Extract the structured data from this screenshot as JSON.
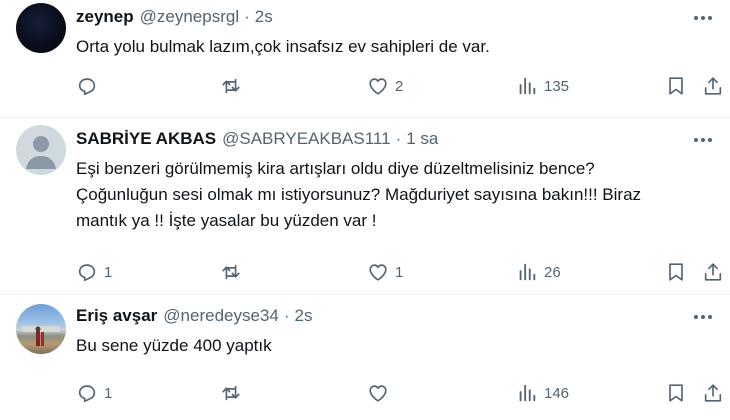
{
  "tweets": [
    {
      "name": "zeynep",
      "handle": "@zeynepsrgl",
      "dot": "·",
      "time": "2s",
      "lines": [
        "Orta yolu bulmak lazım,çok insafsız ev sahipleri de var."
      ],
      "reply_count": "",
      "retweet_count": "",
      "like_count": "2",
      "view_count": "135"
    },
    {
      "name": "SABRİYE AKBAS",
      "handle": "@SABRYEAKBAS111",
      "dot": "·",
      "time": "1 sa",
      "lines": [
        "Eşi benzeri görülmemiş kira artışları oldu diye düzeltmelisiniz bence?",
        "Çoğunluğun sesi olmak mı istiyorsunuz? Mağduriyet sayısına bakın!!! Biraz",
        "mantık ya !! İşte yasalar bu yüzden var !"
      ],
      "reply_count": "1",
      "retweet_count": "",
      "like_count": "1",
      "view_count": "26"
    },
    {
      "name": "Eriş avşar",
      "handle": "@neredeyse34",
      "dot": "·",
      "time": "2s",
      "lines": [
        "Bu sene yüzde 400 yaptık"
      ],
      "reply_count": "1",
      "retweet_count": "",
      "like_count": "",
      "view_count": "146"
    }
  ],
  "icons": {
    "more": "more-dots-icon",
    "reply": "reply-bubble-icon",
    "retweet": "retweet-arrows-icon",
    "like": "heart-icon",
    "views": "views-bar-chart-icon",
    "bookmark": "bookmark-icon",
    "share": "share-upload-icon"
  },
  "colors": {
    "text": "#0f1419",
    "secondary": "#536471",
    "divider": "#eff3f4",
    "background": "#ffffff"
  }
}
